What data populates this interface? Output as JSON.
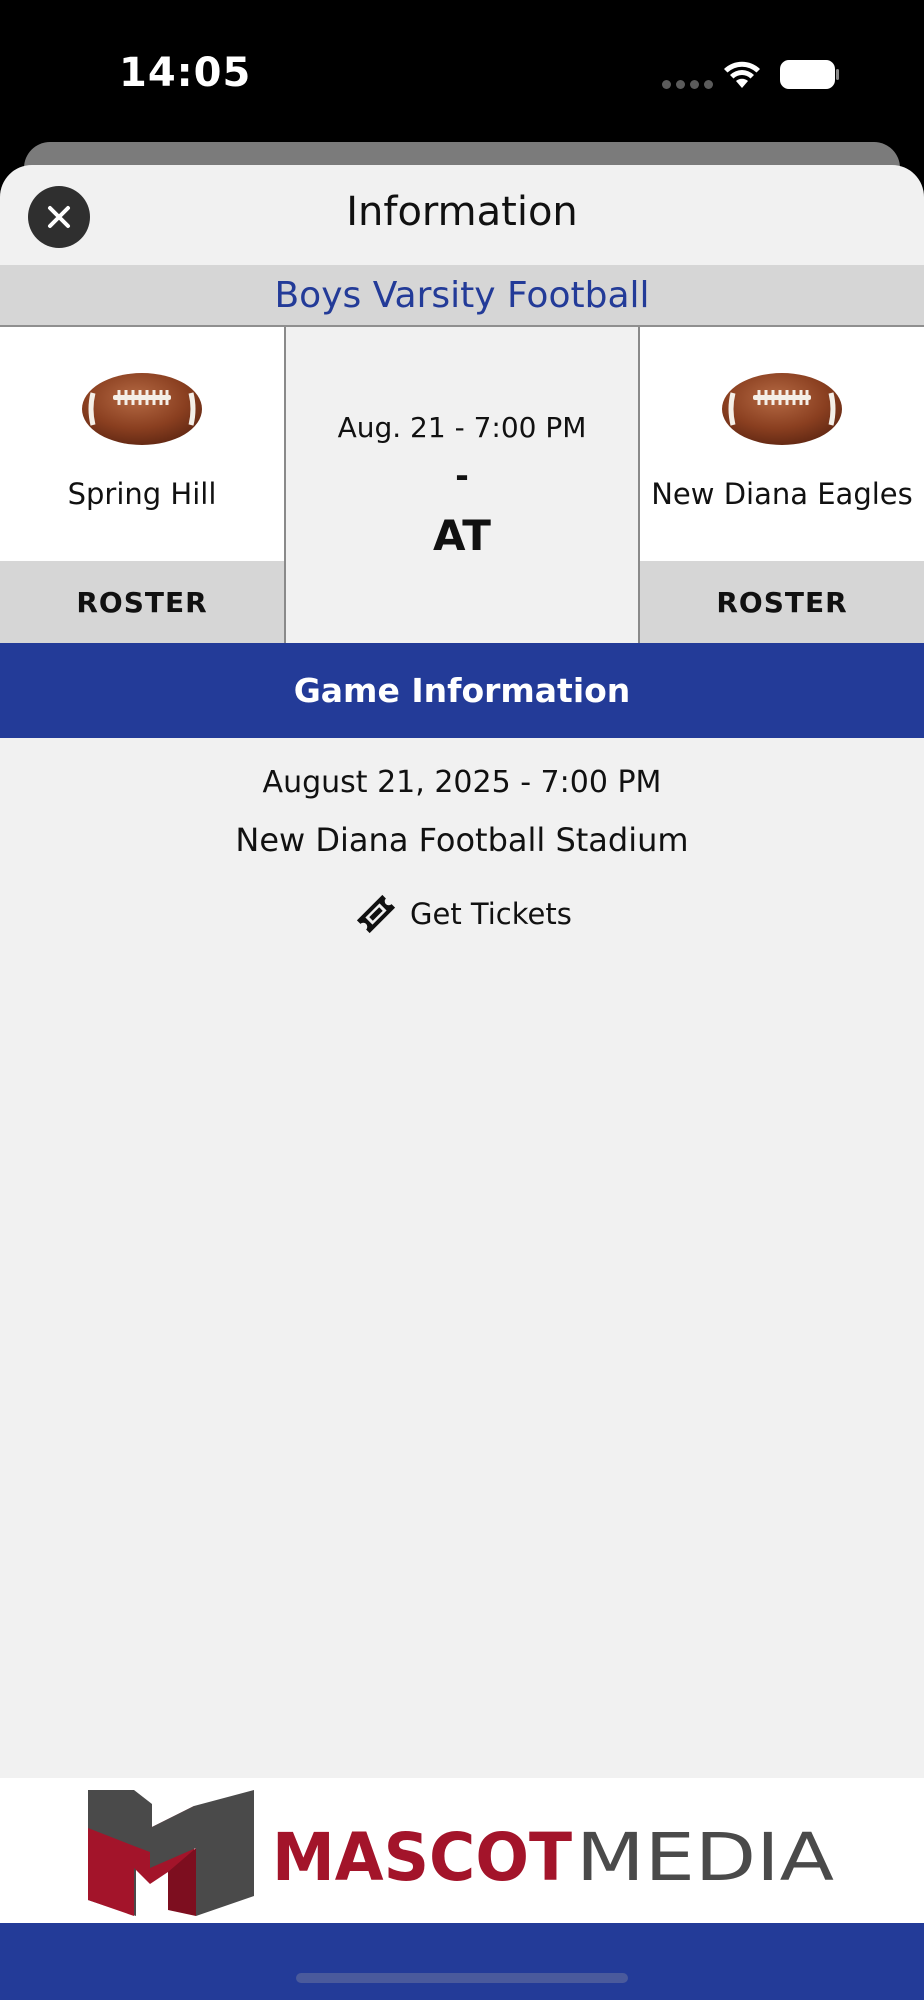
{
  "status_bar": {
    "time": "14:05"
  },
  "nav": {
    "title": "Information",
    "close_icon": "close-icon"
  },
  "sport": {
    "title": "Boys Varsity Football"
  },
  "matchup": {
    "home": {
      "name": "Spring Hill",
      "roster_label": "ROSTER",
      "icon": "football-icon"
    },
    "away": {
      "name": "New Diana Eagles",
      "roster_label": "ROSTER",
      "icon": "football-icon"
    },
    "datetime": "Aug. 21 - 7:00 PM",
    "score": "-",
    "status": "AT"
  },
  "game_info": {
    "header": "Game Information",
    "date": "August 21, 2025 - 7:00 PM",
    "venue": "New Diana Football Stadium",
    "tickets_label": "Get Tickets",
    "tickets_icon": "ticket-icon"
  },
  "sponsor": {
    "name_part1": "MASCOT",
    "name_part2": "MEDIA"
  },
  "colors": {
    "brand_blue": "#233b98",
    "logo_red": "#a3142a",
    "logo_gray": "#4a4a4a"
  }
}
